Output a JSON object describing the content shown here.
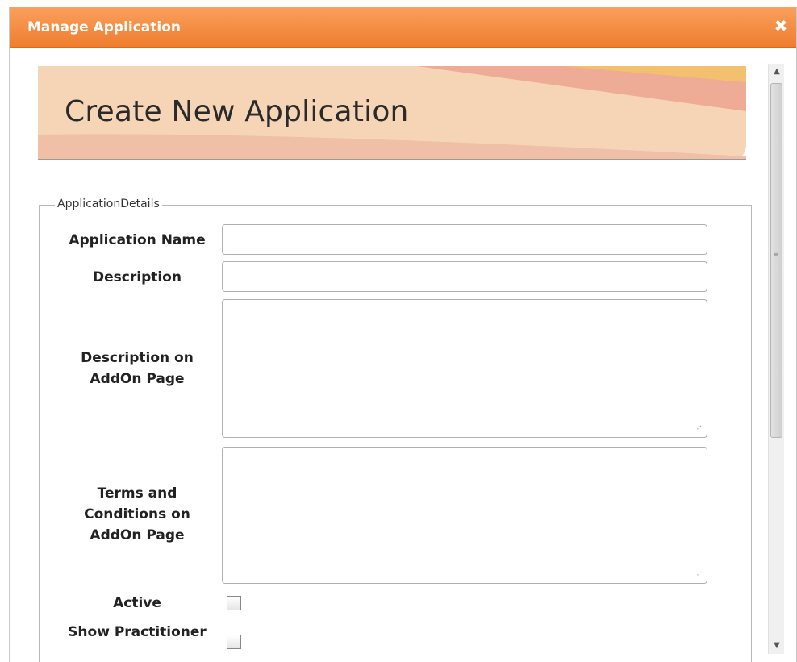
{
  "dialog": {
    "title": "Manage Application",
    "close_symbol": "✖"
  },
  "banner": {
    "heading": "Create New Application"
  },
  "form": {
    "legend": "ApplicationDetails",
    "fields": {
      "app_name_label": "Application Name",
      "app_name_value": "",
      "description_label": "Description",
      "description_value": "",
      "addon_desc_label_line1": "Description on",
      "addon_desc_label_line2": "AddOn Page",
      "addon_desc_value": "",
      "terms_label_line1": "Terms and",
      "terms_label_line2": "Conditions on",
      "terms_label_line3": "AddOn Page",
      "terms_value": "",
      "active_label": "Active",
      "active_checked": false,
      "show_practitioner_label": "Show Practitioner",
      "show_practitioner_checked": false
    }
  },
  "colors": {
    "title_bar": "#ef7d2e",
    "banner_fill": "#f6d5b6",
    "banner_accent": "#eea990"
  },
  "icons": {
    "close": "close-icon",
    "scroll_up": "scroll-up-arrow-icon",
    "scroll_down": "scroll-down-arrow-icon",
    "resize_grip": "resize-grip-icon"
  }
}
